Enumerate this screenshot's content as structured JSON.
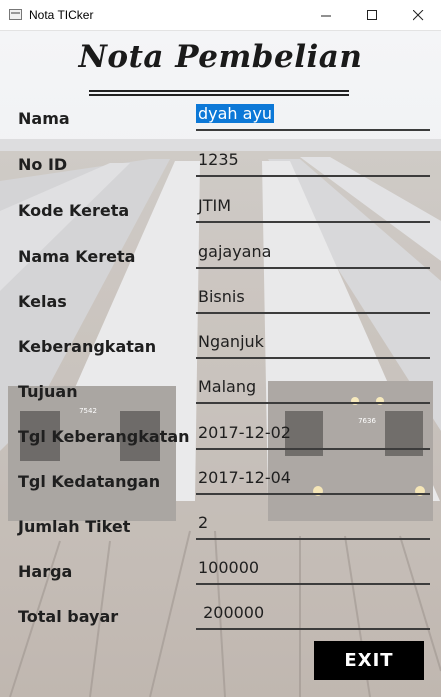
{
  "window": {
    "title": "Nota TICker",
    "icon": "app-window-icon"
  },
  "heading": "Nota Pembelian",
  "fields": [
    {
      "label": "Nama",
      "value": "dyah ayu",
      "selected": true
    },
    {
      "label": "No ID",
      "value": "1235"
    },
    {
      "label": "Kode Kereta",
      "value": "JTIM"
    },
    {
      "label": "Nama Kereta",
      "value": "gajayana"
    },
    {
      "label": "Kelas",
      "value": "Bisnis"
    },
    {
      "label": "Keberangkatan",
      "value": "Nganjuk"
    },
    {
      "label": "Tujuan",
      "value": "Malang"
    },
    {
      "label": "Tgl Keberangkatan",
      "value": "2017-12-02"
    },
    {
      "label": "Tgl Kedatangan",
      "value": "2017-12-04"
    },
    {
      "label": "Jumlah Tiket",
      "value": "2"
    },
    {
      "label": "Harga",
      "value": "100000"
    },
    {
      "label": "Total bayar",
      "value": " 200000"
    }
  ],
  "exit_label": "EXIT",
  "train_numbers": [
    "7542",
    "7636"
  ],
  "colors": {
    "selection": "#0c78d7",
    "exit_bg": "#000000",
    "underline": "#3c3c3c"
  }
}
